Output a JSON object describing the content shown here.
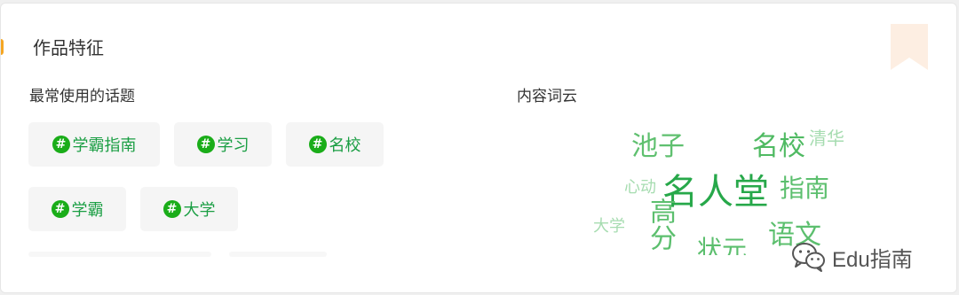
{
  "card": {
    "title": "作品特征"
  },
  "topics": {
    "title": "最常使用的话题",
    "hash_symbol": "#",
    "items": [
      {
        "label": "学霸指南"
      },
      {
        "label": "学习"
      },
      {
        "label": "名校"
      },
      {
        "label": "学霸"
      },
      {
        "label": "大学"
      }
    ]
  },
  "word_cloud": {
    "title": "内容词云",
    "words": [
      {
        "text": "池子"
      },
      {
        "text": "名校"
      },
      {
        "text": "清华"
      },
      {
        "text": "心动"
      },
      {
        "text": "名人堂"
      },
      {
        "text": "指南"
      },
      {
        "text": "大学"
      },
      {
        "text": "高分"
      },
      {
        "text": "语文"
      },
      {
        "text": "状元"
      }
    ]
  },
  "watermark": {
    "text": "Edu指南",
    "icon": "wechat-icon"
  },
  "colors": {
    "accent": "#f5a623",
    "topic_green": "#1aad19",
    "cloud_green": "#5cbf6e",
    "bookmark": "#fdeee2"
  }
}
